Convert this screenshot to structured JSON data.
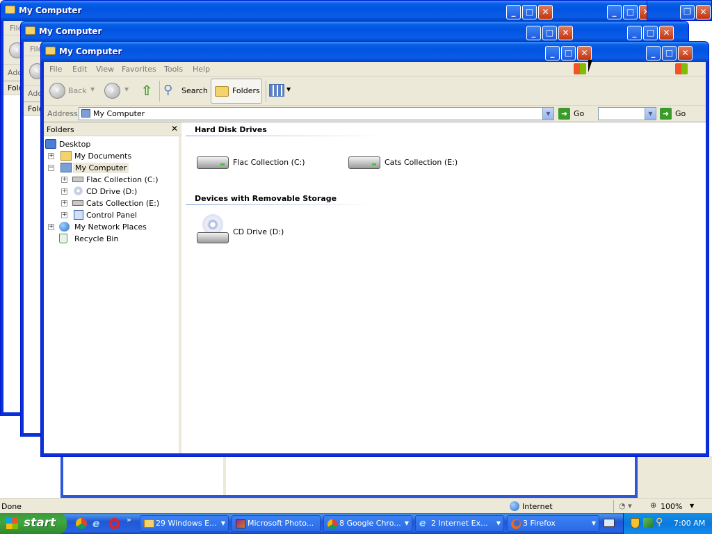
{
  "window": {
    "title": "My Computer",
    "menu": [
      "File",
      "Edit",
      "View",
      "Favorites",
      "Tools",
      "Help"
    ],
    "back_label": "Back",
    "search_label": "Search",
    "folders_label": "Folders",
    "address_label": "Address",
    "address_value": "My Computer",
    "go_label": "Go"
  },
  "bg_window": {
    "file_label": "File",
    "address_label": "Add",
    "folders_label": "Fold",
    "go_label": "Go"
  },
  "folders_pane": {
    "title": "Folders",
    "close": "✕",
    "nodes": {
      "desktop": "Desktop",
      "my_documents": "My Documents",
      "my_computer": "My Computer",
      "flac": "Flac Collection (C:)",
      "cd": "CD Drive (D:)",
      "cats": "Cats Collection (E:)",
      "control_panel": "Control Panel",
      "network": "My Network Places",
      "recycle": "Recycle Bin"
    }
  },
  "content": {
    "hard_disk_group": "Hard Disk Drives",
    "removable_group": "Devices with Removable Storage",
    "drive_c": "Flac Collection (C:)",
    "drive_e": "Cats Collection (E:)",
    "drive_d": "CD Drive (D:)"
  },
  "status": {
    "left": "Done",
    "zone": "Internet",
    "zoom": "100%"
  },
  "taskbar": {
    "start": "start",
    "buttons": {
      "explorer": "29 Windows E...",
      "photo": "Microsoft Photo...",
      "chrome": "8 Google Chro...",
      "ie": "2 Internet Ex...",
      "firefox": "3 Firefox"
    },
    "clock": "7:00 AM"
  },
  "colors": {
    "titlebar": "#0054e3",
    "taskbar": "#2157d7",
    "start": "#3fa83f"
  }
}
